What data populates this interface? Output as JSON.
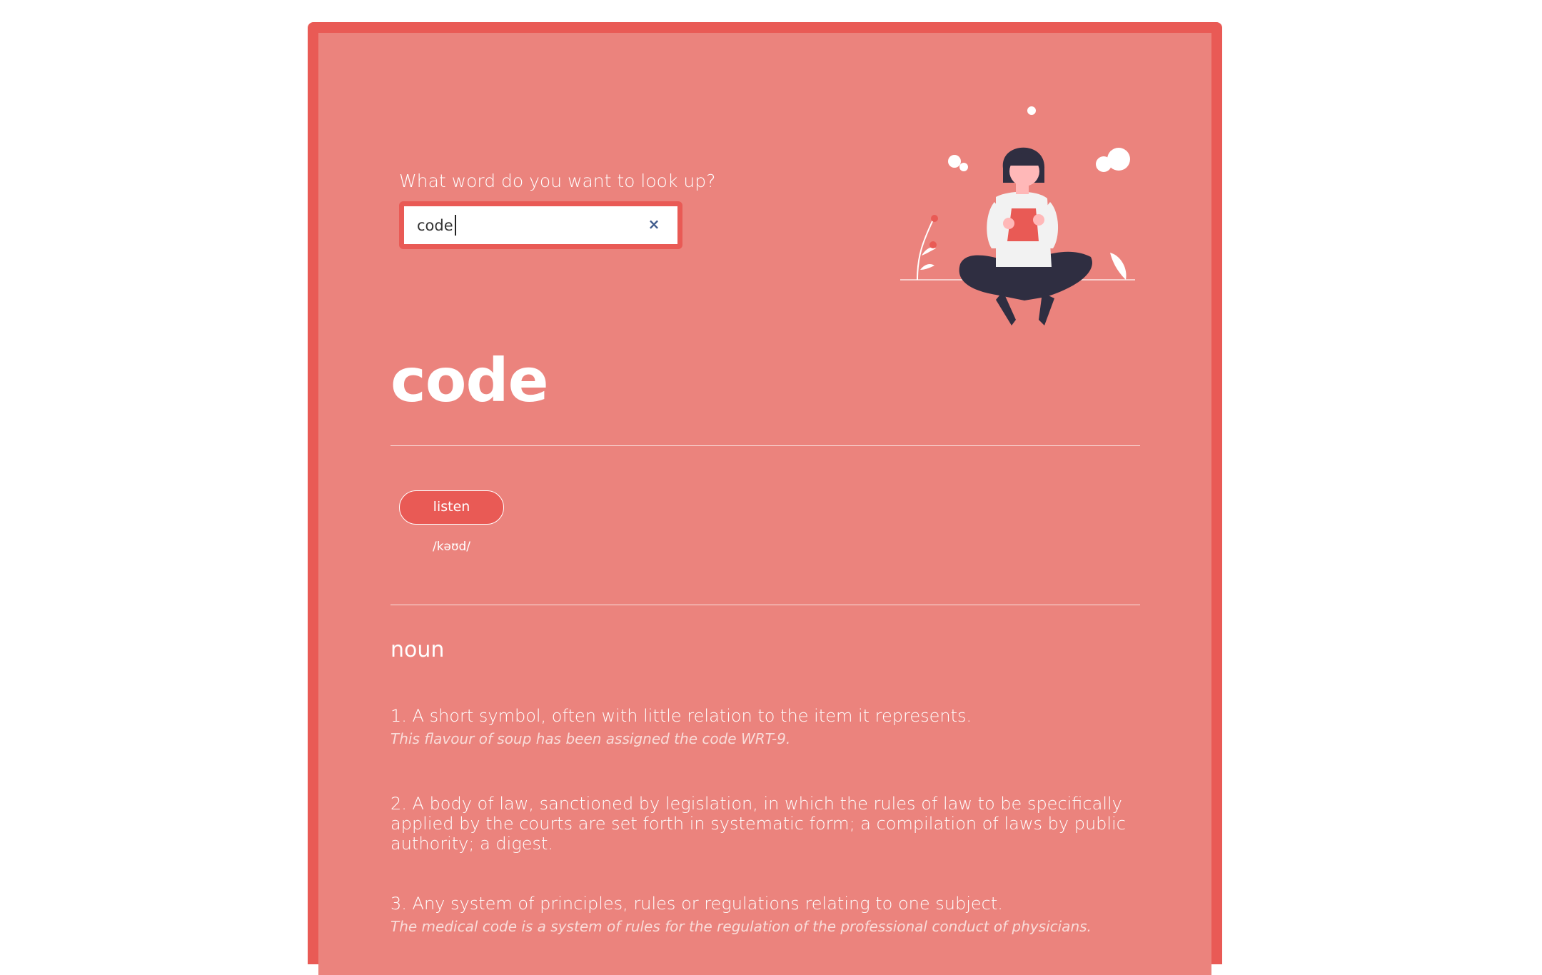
{
  "search": {
    "prompt": "What word do you want to look up?",
    "value": "code",
    "clear_icon": "×"
  },
  "entry": {
    "word": "code",
    "listen_label": "listen",
    "phonetic": "/kəʊd/",
    "part_of_speech": "noun",
    "definitions": [
      {
        "text": "1. A short symbol, often with little relation to the item it represents.",
        "example": "This flavour of soup has been assigned the code WRT-9."
      },
      {
        "text": "2. A body of law, sanctioned by legislation, in which the rules of law to be specifically applied by the courts are set forth in systematic form; a compilation of laws by public authority; a digest.",
        "example": ""
      },
      {
        "text": "3. Any system of principles, rules or regulations relating to one subject.",
        "example": "The medical code is a system of rules for the regulation of the professional conduct of physicians."
      }
    ]
  },
  "colors": {
    "frame": "#e95a55",
    "panel": "#eb837d",
    "text": "#ffffff",
    "clear_icon": "#3f5a8c",
    "illustration_dark": "#2f2e41",
    "illustration_skin": "#ffb8b8"
  },
  "icons": {
    "clear": "close-icon",
    "illustration": "person-reading-illustration"
  }
}
